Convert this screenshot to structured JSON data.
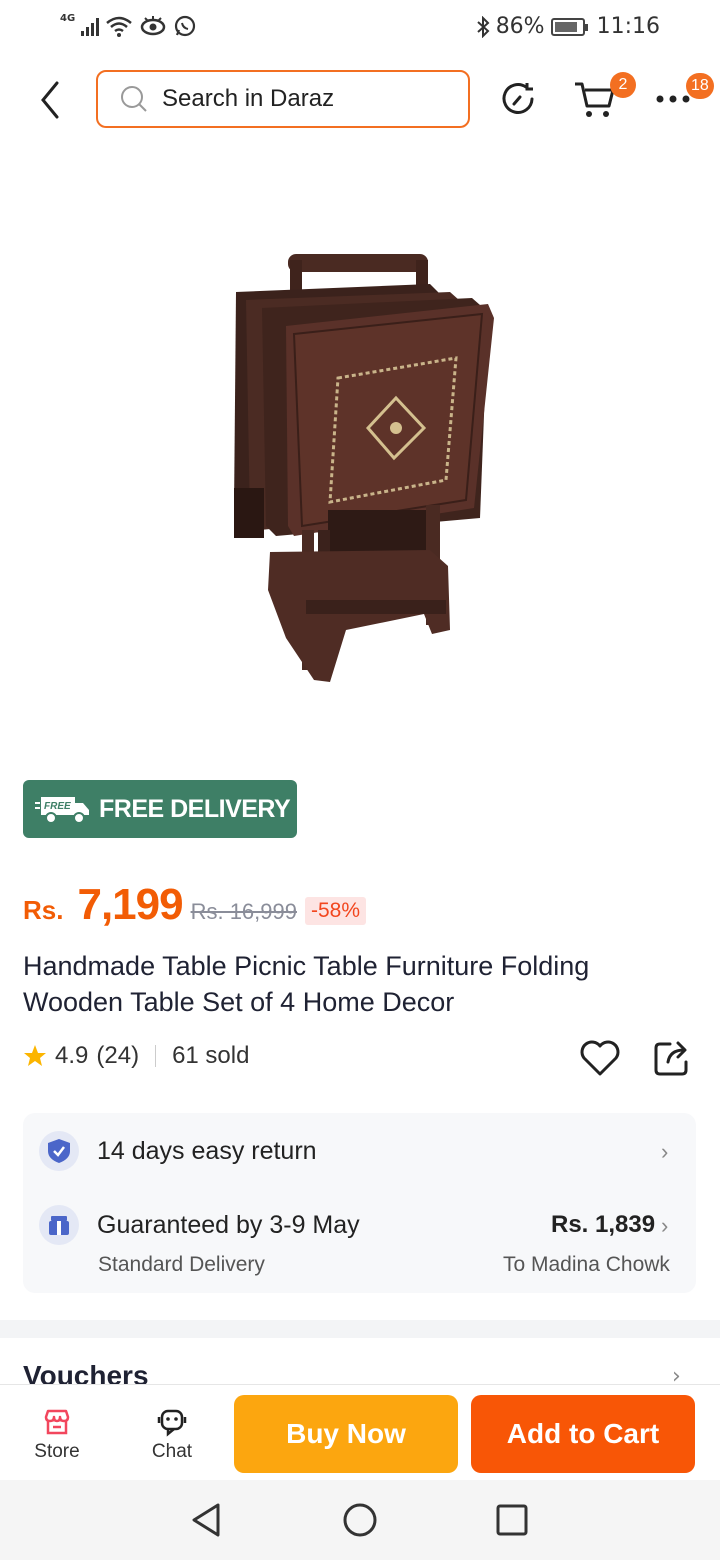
{
  "status_bar": {
    "network": "4G",
    "battery_percent": "86%",
    "battery_level": 0.86,
    "time": "11:16",
    "icons": [
      "signal-icon",
      "wifi-icon",
      "eye-icon",
      "whatsapp-icon",
      "bluetooth-icon",
      "battery-icon"
    ]
  },
  "header": {
    "search_placeholder": "Search in Daraz",
    "cart_count": "2",
    "more_count": "18",
    "icons": [
      "back-icon",
      "search-icon",
      "history-icon",
      "cart-icon",
      "more-icon"
    ]
  },
  "product": {
    "free_delivery_tag": "FREE",
    "free_delivery_label": "FREE DELIVERY",
    "currency": "Rs.",
    "price": "7,199",
    "original_price": "Rs. 16,999",
    "discount": "-58%",
    "title": "Handmade Table Picnic Table Furniture Folding Wooden Table Set of 4 Home Decor",
    "rating": "4.9",
    "rating_count": "(24)",
    "sold": "61 sold"
  },
  "services": {
    "return_label": "14 days easy return",
    "delivery_label": "Guaranteed by 3-9 May",
    "delivery_type": "Standard Delivery",
    "delivery_fee": "Rs. 1,839",
    "delivery_location": "To Madina Chowk"
  },
  "sections": {
    "vouchers": "Vouchers"
  },
  "bottom_bar": {
    "store": "Store",
    "chat": "Chat",
    "buy_now": "Buy Now",
    "add_to_cart": "Add to Cart"
  },
  "colors": {
    "brand_orange": "#f85606",
    "buy_now_yellow": "#fca60f",
    "free_delivery_green": "#3e7f66",
    "price_orange": "#f25c05"
  }
}
